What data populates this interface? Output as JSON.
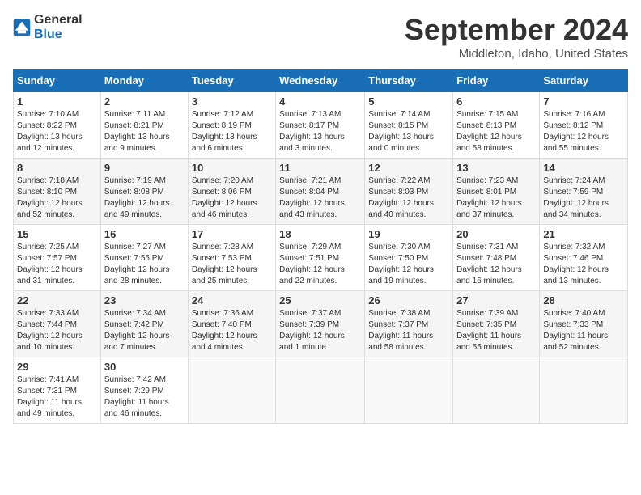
{
  "logo": {
    "general": "General",
    "blue": "Blue"
  },
  "title": "September 2024",
  "location": "Middleton, Idaho, United States",
  "days_of_week": [
    "Sunday",
    "Monday",
    "Tuesday",
    "Wednesday",
    "Thursday",
    "Friday",
    "Saturday"
  ],
  "weeks": [
    [
      {
        "day": "1",
        "info": "Sunrise: 7:10 AM\nSunset: 8:22 PM\nDaylight: 13 hours\nand 12 minutes."
      },
      {
        "day": "2",
        "info": "Sunrise: 7:11 AM\nSunset: 8:21 PM\nDaylight: 13 hours\nand 9 minutes."
      },
      {
        "day": "3",
        "info": "Sunrise: 7:12 AM\nSunset: 8:19 PM\nDaylight: 13 hours\nand 6 minutes."
      },
      {
        "day": "4",
        "info": "Sunrise: 7:13 AM\nSunset: 8:17 PM\nDaylight: 13 hours\nand 3 minutes."
      },
      {
        "day": "5",
        "info": "Sunrise: 7:14 AM\nSunset: 8:15 PM\nDaylight: 13 hours\nand 0 minutes."
      },
      {
        "day": "6",
        "info": "Sunrise: 7:15 AM\nSunset: 8:13 PM\nDaylight: 12 hours\nand 58 minutes."
      },
      {
        "day": "7",
        "info": "Sunrise: 7:16 AM\nSunset: 8:12 PM\nDaylight: 12 hours\nand 55 minutes."
      }
    ],
    [
      {
        "day": "8",
        "info": "Sunrise: 7:18 AM\nSunset: 8:10 PM\nDaylight: 12 hours\nand 52 minutes."
      },
      {
        "day": "9",
        "info": "Sunrise: 7:19 AM\nSunset: 8:08 PM\nDaylight: 12 hours\nand 49 minutes."
      },
      {
        "day": "10",
        "info": "Sunrise: 7:20 AM\nSunset: 8:06 PM\nDaylight: 12 hours\nand 46 minutes."
      },
      {
        "day": "11",
        "info": "Sunrise: 7:21 AM\nSunset: 8:04 PM\nDaylight: 12 hours\nand 43 minutes."
      },
      {
        "day": "12",
        "info": "Sunrise: 7:22 AM\nSunset: 8:03 PM\nDaylight: 12 hours\nand 40 minutes."
      },
      {
        "day": "13",
        "info": "Sunrise: 7:23 AM\nSunset: 8:01 PM\nDaylight: 12 hours\nand 37 minutes."
      },
      {
        "day": "14",
        "info": "Sunrise: 7:24 AM\nSunset: 7:59 PM\nDaylight: 12 hours\nand 34 minutes."
      }
    ],
    [
      {
        "day": "15",
        "info": "Sunrise: 7:25 AM\nSunset: 7:57 PM\nDaylight: 12 hours\nand 31 minutes."
      },
      {
        "day": "16",
        "info": "Sunrise: 7:27 AM\nSunset: 7:55 PM\nDaylight: 12 hours\nand 28 minutes."
      },
      {
        "day": "17",
        "info": "Sunrise: 7:28 AM\nSunset: 7:53 PM\nDaylight: 12 hours\nand 25 minutes."
      },
      {
        "day": "18",
        "info": "Sunrise: 7:29 AM\nSunset: 7:51 PM\nDaylight: 12 hours\nand 22 minutes."
      },
      {
        "day": "19",
        "info": "Sunrise: 7:30 AM\nSunset: 7:50 PM\nDaylight: 12 hours\nand 19 minutes."
      },
      {
        "day": "20",
        "info": "Sunrise: 7:31 AM\nSunset: 7:48 PM\nDaylight: 12 hours\nand 16 minutes."
      },
      {
        "day": "21",
        "info": "Sunrise: 7:32 AM\nSunset: 7:46 PM\nDaylight: 12 hours\nand 13 minutes."
      }
    ],
    [
      {
        "day": "22",
        "info": "Sunrise: 7:33 AM\nSunset: 7:44 PM\nDaylight: 12 hours\nand 10 minutes."
      },
      {
        "day": "23",
        "info": "Sunrise: 7:34 AM\nSunset: 7:42 PM\nDaylight: 12 hours\nand 7 minutes."
      },
      {
        "day": "24",
        "info": "Sunrise: 7:36 AM\nSunset: 7:40 PM\nDaylight: 12 hours\nand 4 minutes."
      },
      {
        "day": "25",
        "info": "Sunrise: 7:37 AM\nSunset: 7:39 PM\nDaylight: 12 hours\nand 1 minute."
      },
      {
        "day": "26",
        "info": "Sunrise: 7:38 AM\nSunset: 7:37 PM\nDaylight: 11 hours\nand 58 minutes."
      },
      {
        "day": "27",
        "info": "Sunrise: 7:39 AM\nSunset: 7:35 PM\nDaylight: 11 hours\nand 55 minutes."
      },
      {
        "day": "28",
        "info": "Sunrise: 7:40 AM\nSunset: 7:33 PM\nDaylight: 11 hours\nand 52 minutes."
      }
    ],
    [
      {
        "day": "29",
        "info": "Sunrise: 7:41 AM\nSunset: 7:31 PM\nDaylight: 11 hours\nand 49 minutes."
      },
      {
        "day": "30",
        "info": "Sunrise: 7:42 AM\nSunset: 7:29 PM\nDaylight: 11 hours\nand 46 minutes."
      },
      null,
      null,
      null,
      null,
      null
    ]
  ]
}
